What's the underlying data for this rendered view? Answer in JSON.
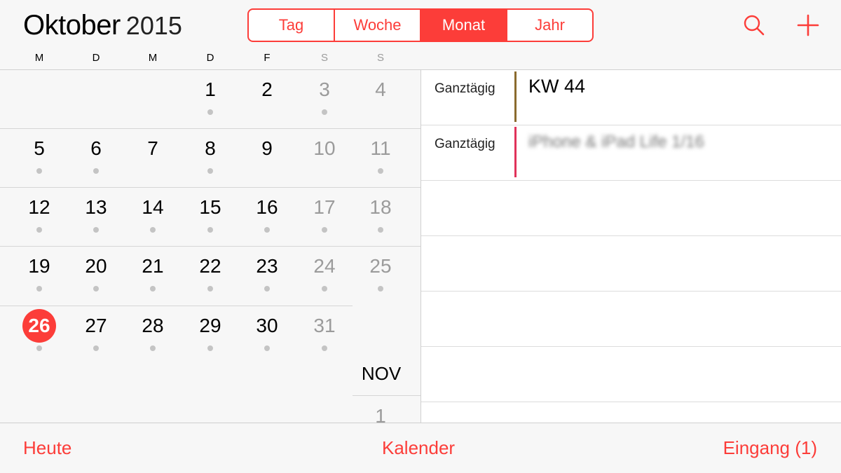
{
  "header": {
    "month": "Oktober",
    "year": "2015",
    "view_tabs": [
      {
        "label": "Tag",
        "active": false
      },
      {
        "label": "Woche",
        "active": false
      },
      {
        "label": "Monat",
        "active": true
      },
      {
        "label": "Jahr",
        "active": false
      }
    ],
    "search_icon": "search-icon",
    "add_icon": "plus-icon"
  },
  "weekdays": [
    "M",
    "D",
    "M",
    "D",
    "F",
    "S",
    "S"
  ],
  "weeks": [
    [
      "",
      "",
      "",
      "1",
      "2",
      "3",
      "4"
    ],
    [
      "5",
      "6",
      "7",
      "8",
      "9",
      "10",
      "11"
    ],
    [
      "12",
      "13",
      "14",
      "15",
      "16",
      "17",
      "18"
    ],
    [
      "19",
      "20",
      "21",
      "22",
      "23",
      "24",
      "25"
    ],
    [
      "26",
      "27",
      "28",
      "29",
      "30",
      "31",
      ""
    ]
  ],
  "today": "26",
  "next_month": {
    "label": "NOV",
    "first_day": "1"
  },
  "events": [
    {
      "label": "Ganztägig",
      "title": "KW 44",
      "color": "#8b6b2e",
      "blurred": false
    },
    {
      "label": "Ganztägig",
      "title": "iPhone & iPad Life 1/16",
      "color": "#e0325a",
      "blurred": true
    }
  ],
  "tabbar": {
    "today": "Heute",
    "calendars": "Kalender",
    "inbox": "Eingang (1)"
  },
  "colors": {
    "accent": "#fc3d39",
    "weekend_text": "#9b9b9b",
    "event_dot": "#c4c4c4"
  }
}
